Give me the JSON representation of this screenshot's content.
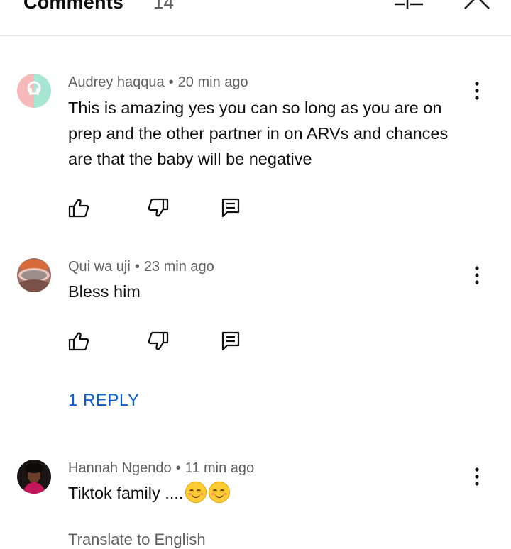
{
  "header": {
    "title": "Comments",
    "count": "14"
  },
  "comments": [
    {
      "author": "Audrey haqqua",
      "time": "20 min ago",
      "text": "This is amazing yes you can so long as you are on prep and the other partner in on ARVs and chances are that the baby will be negative"
    },
    {
      "author": "Qui wa uji",
      "time": "23 min ago",
      "text": "Bless him",
      "replies_label": "1 REPLY"
    },
    {
      "author": "Hannah Ngendo",
      "time": "11 min ago",
      "text": "Tiktok family ....",
      "translate_label": "Translate to English"
    }
  ],
  "icons": {
    "sort": "sort-icon",
    "close": "close-icon",
    "more": "more-vert-icon",
    "like": "thumb-up-icon",
    "dislike": "thumb-down-icon",
    "reply": "reply-icon"
  },
  "colors": {
    "link": "#065fd4",
    "secondary_text": "#606060",
    "divider": "#e5e5e5"
  }
}
